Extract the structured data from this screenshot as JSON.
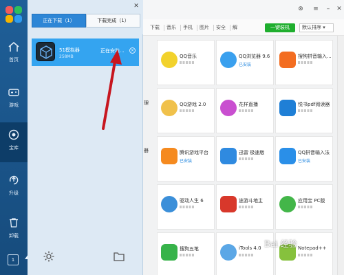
{
  "nav": {
    "items": [
      {
        "label": "首页",
        "icon": "home-icon"
      },
      {
        "label": "游戏",
        "icon": "gamepad-icon"
      },
      {
        "label": "宝库",
        "icon": "treasure-icon"
      },
      {
        "label": "升级",
        "icon": "upgrade-icon"
      },
      {
        "label": "卸载",
        "icon": "trash-icon"
      }
    ],
    "badge": "1"
  },
  "tabs": [
    "下载",
    "音乐",
    "手机",
    "图片",
    "安全",
    "解"
  ],
  "green_button": "一键装机",
  "sort": "默认排序",
  "apps": [
    {
      "name": "QQ音乐"
    },
    {
      "name": "QQ浏览器 9.6",
      "status": "已安装"
    },
    {
      "name": "搜狗拼音输入..."
    },
    {
      "name": "QQ游戏 2.0"
    },
    {
      "name": "花样直播"
    },
    {
      "name": "悦书pdf阅读器"
    },
    {
      "name": "腾讯游戏平台",
      "status": "已安装"
    },
    {
      "name": "迅雷 极速版"
    },
    {
      "name": "QQ拼音输入法",
      "status": "已安装"
    },
    {
      "name": "驱动人生 6"
    },
    {
      "name": "途游斗地主"
    },
    {
      "name": "应用宝 PC版"
    },
    {
      "name": "搜狗五笔"
    },
    {
      "name": "iTools 4.0"
    },
    {
      "name": "Notepad++"
    }
  ],
  "cut_labels": [
    "理",
    "器"
  ],
  "download_panel": {
    "tab_downloading": "正在下载（1）",
    "tab_completed": "下载完成（1）",
    "item": {
      "name": "51模拟器",
      "size": "258MB",
      "status": "正在安装..."
    }
  },
  "watermark": "Bai 经验"
}
